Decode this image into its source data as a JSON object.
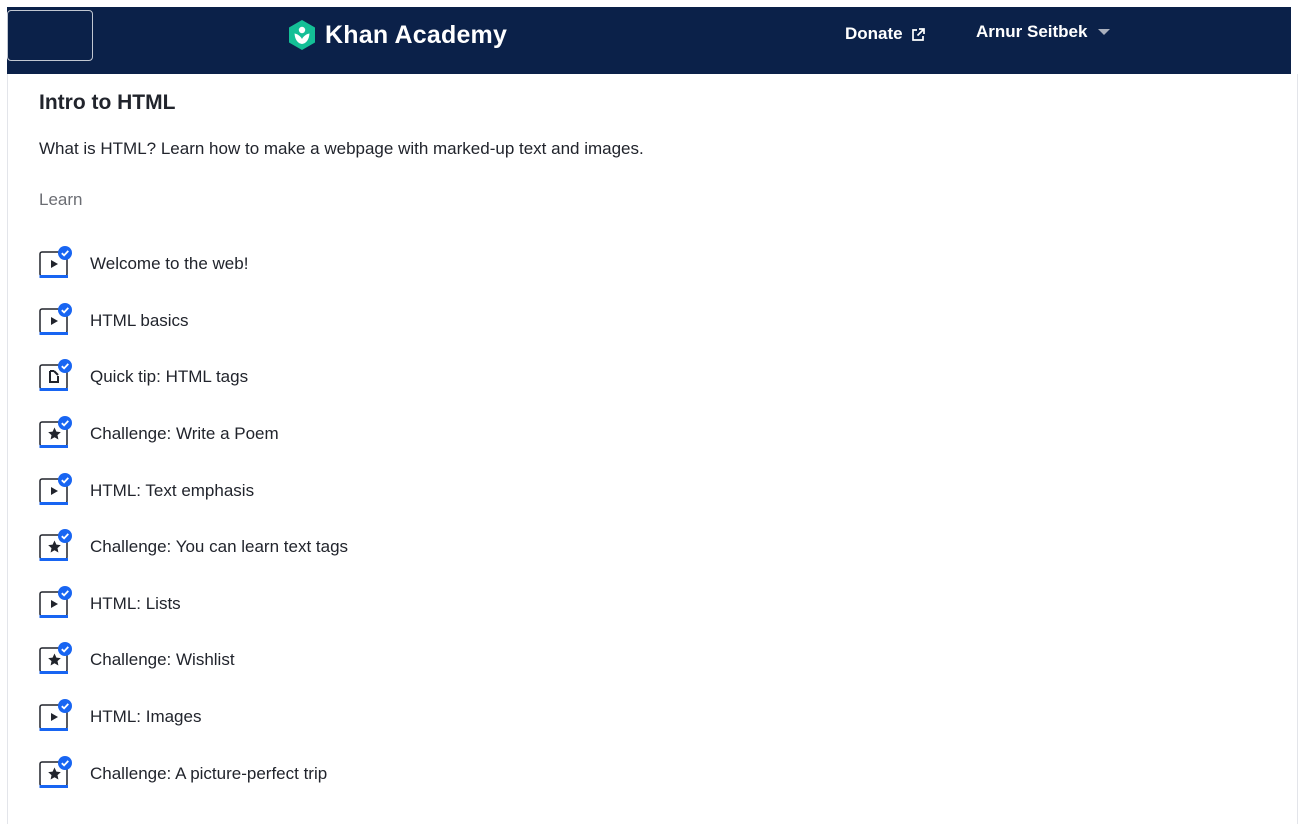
{
  "header": {
    "brand": "Khan Academy",
    "donate_label": "Donate",
    "user_name": "Arnur Seitbek",
    "colors": {
      "bar": "#0b2149",
      "logo": "#14bf96"
    }
  },
  "course": {
    "title": "Intro to HTML",
    "description": "What is HTML? Learn how to make a webpage with marked-up text and images.",
    "section_label": "Learn",
    "items": [
      {
        "label": "Welcome to the web!",
        "type": "video",
        "completed": true
      },
      {
        "label": "HTML basics",
        "type": "video",
        "completed": true
      },
      {
        "label": "Quick tip: HTML tags",
        "type": "article",
        "completed": true
      },
      {
        "label": "Challenge: Write a Poem",
        "type": "challenge",
        "completed": true
      },
      {
        "label": "HTML: Text emphasis",
        "type": "video",
        "completed": true
      },
      {
        "label": "Challenge: You can learn text tags",
        "type": "challenge",
        "completed": true
      },
      {
        "label": "HTML: Lists",
        "type": "video",
        "completed": true
      },
      {
        "label": "Challenge: Wishlist",
        "type": "challenge",
        "completed": true
      },
      {
        "label": "HTML: Images",
        "type": "video",
        "completed": true
      },
      {
        "label": "Challenge: A picture-perfect trip",
        "type": "challenge",
        "completed": true
      }
    ],
    "colors": {
      "complete": "#1865f2",
      "icon_stroke": "#21242c"
    }
  }
}
